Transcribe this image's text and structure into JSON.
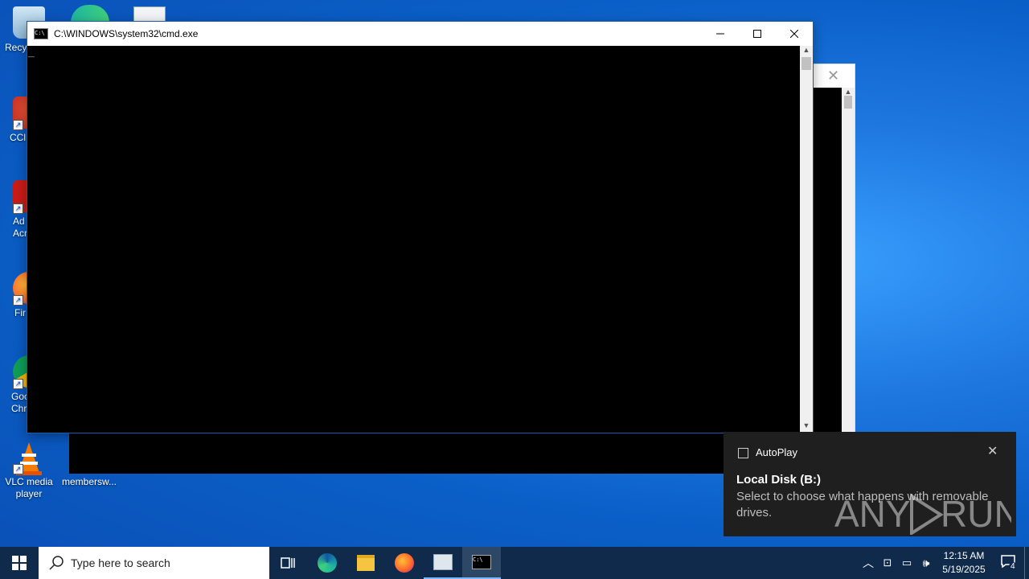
{
  "desktop": {
    "icons": [
      {
        "label": "Recy"
      },
      {
        "label": "CCl"
      },
      {
        "label": "Ad Acr"
      },
      {
        "label": "Fir"
      },
      {
        "label": "Goo Chr"
      },
      {
        "label": "VLC media player"
      },
      {
        "label": "membersw..."
      }
    ]
  },
  "cmd_window": {
    "title": "C:\\WINDOWS\\system32\\cmd.exe",
    "cursor": "_"
  },
  "autoplay": {
    "app": "AutoPlay",
    "heading": "Local Disk (B:)",
    "body": "Select to choose what happens with removable drives."
  },
  "watermark": "ANY RUN",
  "taskbar": {
    "search_placeholder": "Type here to search",
    "time": "12:15 AM",
    "date": "5/19/2025",
    "notification_count": "4"
  },
  "colors": {
    "taskbar": "#0f2a4a",
    "toast": "#1f1f1f",
    "accent": "#0078d7"
  }
}
